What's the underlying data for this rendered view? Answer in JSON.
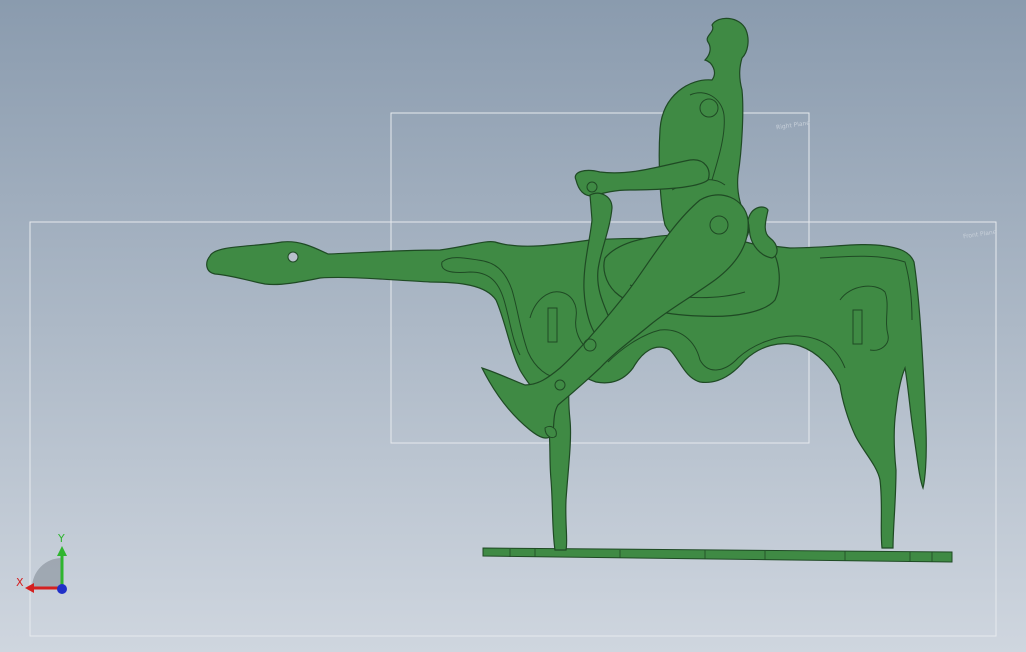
{
  "viewport": {
    "colors": {
      "background_top": "#8a9bae",
      "background_bottom": "#cfd6df",
      "part_fill": "#3f8a44",
      "part_edge": "#1f4a24",
      "plane_edge": "#e6eaee",
      "axis_x": "#d42020",
      "axis_y": "#2fb52f",
      "axis_z": "#2030c8"
    },
    "planes": [
      {
        "label": "Front Plane"
      },
      {
        "label": "Right Plane"
      }
    ],
    "triad": {
      "x_label": "X",
      "y_label": "Y",
      "icon": "triad-axes-icon"
    }
  }
}
